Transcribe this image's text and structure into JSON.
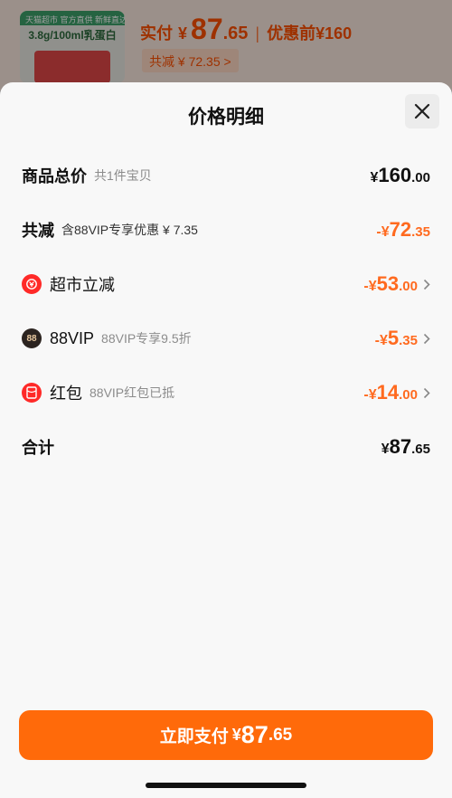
{
  "background": {
    "thumb_band": "天猫超市 官方直供 新鲜直达",
    "thumb_line": "3.8g/100ml乳蛋白",
    "pay_label": "实付",
    "pay_yen": "¥",
    "pay_int": "87",
    "pay_dec": ".65",
    "separator": "|",
    "before_label": "优惠前",
    "before_value": "¥160",
    "reduce_text": "共减 ¥ 72.35 >"
  },
  "sheet": {
    "title": "价格明细",
    "rows": [
      {
        "main": "商品总价",
        "sub": "共1件宝贝",
        "yen": "¥",
        "int": "160",
        "dec": ".00"
      },
      {
        "main": "共减",
        "sub": "含88VIP专享优惠 ¥ 7.35",
        "yen": "-¥",
        "int": "72",
        "dec": ".35"
      },
      {
        "main": "超市立减",
        "sub": "",
        "yen": "-¥",
        "int": "53",
        "dec": ".00"
      },
      {
        "main": "88VIP",
        "sub": "88VIP专享9.5折",
        "yen": "-¥",
        "int": "5",
        "dec": ".35",
        "icon_text": "88"
      },
      {
        "main": "红包",
        "sub": "88VIP红包已抵",
        "yen": "-¥",
        "int": "14",
        "dec": ".00"
      },
      {
        "main": "合计",
        "sub": "",
        "yen": "¥",
        "int": "87",
        "dec": ".65"
      }
    ]
  },
  "pay_button": {
    "label": "立即支付",
    "yen": "¥",
    "int": "87",
    "dec": ".65"
  },
  "icons": [
    "close-icon",
    "supermarket-discount-icon",
    "88vip-icon",
    "red-packet-icon",
    "chevron-right-icon"
  ],
  "colors": {
    "accent": "#ff6a0a",
    "discount": "#ff6a1f",
    "icon_red": "#ff2a28"
  }
}
